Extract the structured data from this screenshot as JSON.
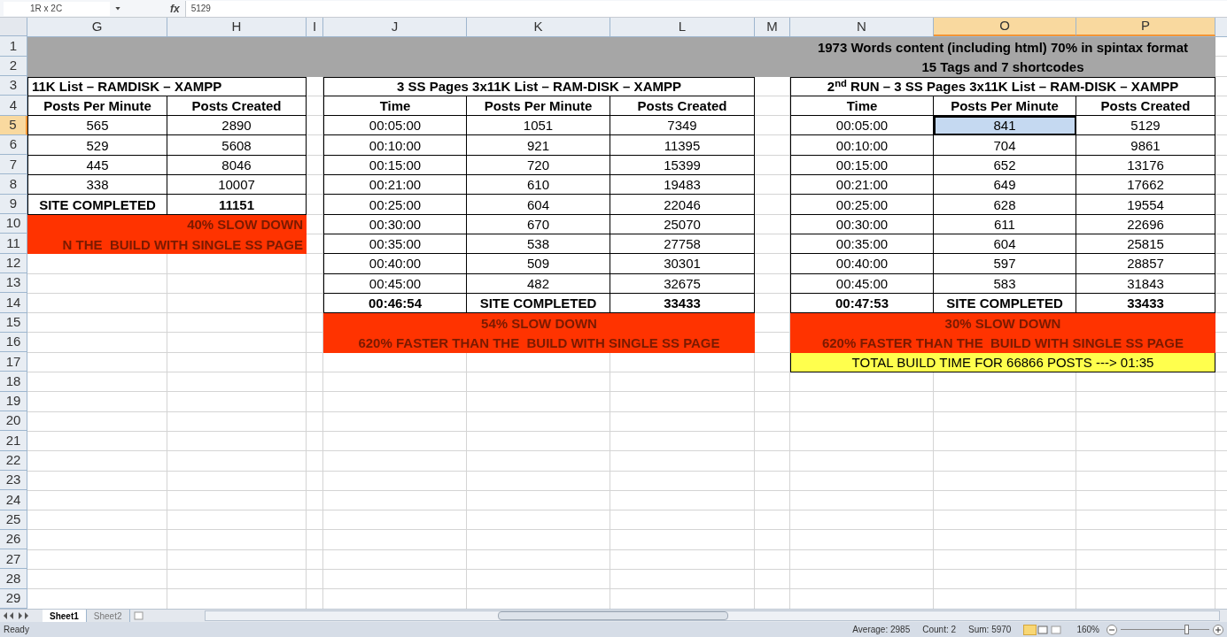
{
  "formula_bar": {
    "name_box": "1R x 2C",
    "function_label": "fx",
    "value": "5129"
  },
  "columns": [
    {
      "label": "G",
      "selected": false
    },
    {
      "label": "H",
      "selected": false
    },
    {
      "label": "I",
      "selected": false
    },
    {
      "label": "J",
      "selected": false
    },
    {
      "label": "K",
      "selected": false
    },
    {
      "label": "L",
      "selected": false
    },
    {
      "label": "M",
      "selected": false
    },
    {
      "label": "N",
      "selected": false
    },
    {
      "label": "O",
      "selected": true
    },
    {
      "label": "P",
      "selected": true
    }
  ],
  "row_headers": [
    {
      "label": "1",
      "selected": false
    },
    {
      "label": "2",
      "selected": false
    },
    {
      "label": "3",
      "selected": false
    },
    {
      "label": "4",
      "selected": false
    },
    {
      "label": "5",
      "selected": true
    },
    {
      "label": "6",
      "selected": false
    },
    {
      "label": "7",
      "selected": false
    },
    {
      "label": "8",
      "selected": false
    },
    {
      "label": "9",
      "selected": false
    },
    {
      "label": "10",
      "selected": false
    },
    {
      "label": "11",
      "selected": false
    },
    {
      "label": "12",
      "selected": false
    },
    {
      "label": "13",
      "selected": false
    },
    {
      "label": "14",
      "selected": false
    },
    {
      "label": "15",
      "selected": false
    },
    {
      "label": "16",
      "selected": false
    },
    {
      "label": "17",
      "selected": false
    },
    {
      "label": "18",
      "selected": false
    },
    {
      "label": "19",
      "selected": false
    },
    {
      "label": "20",
      "selected": false
    },
    {
      "label": "21",
      "selected": false
    },
    {
      "label": "22",
      "selected": false
    },
    {
      "label": "23",
      "selected": false
    },
    {
      "label": "24",
      "selected": false
    },
    {
      "label": "25",
      "selected": false
    },
    {
      "label": "26",
      "selected": false
    },
    {
      "label": "27",
      "selected": false
    },
    {
      "label": "28",
      "selected": false
    },
    {
      "label": "29",
      "selected": false
    }
  ],
  "banner": [
    "1973 Words content (including html) 70% in spintax format",
    "15 Tags and 7 shortcodes"
  ],
  "tables": [
    {
      "title": "11K List – RAMDISK – XAMPP",
      "headers": [
        "Posts Per Minute",
        "Posts Created"
      ],
      "rows": [
        [
          {
            "text": "565",
            "selected": false
          },
          {
            "text": "2890",
            "selected": false
          }
        ],
        [
          {
            "text": "529",
            "selected": false
          },
          {
            "text": "5608",
            "selected": false
          }
        ],
        [
          {
            "text": "445",
            "selected": false
          },
          {
            "text": "8046",
            "selected": false
          }
        ],
        [
          {
            "text": "338",
            "selected": false
          },
          {
            "text": "10007",
            "selected": false
          }
        ]
      ],
      "summary": [
        "SITE COMPLETED",
        "11151"
      ],
      "alerts": [
        "40% SLOW DOWN",
        "N THE  BUILD WITH SINGLE SS PAGE"
      ]
    },
    {
      "title": "3 SS Pages 3x11K List – RAM-DISK – XAMPP",
      "headers": [
        "Time",
        "Posts Per Minute",
        "Posts Created"
      ],
      "rows": [
        [
          {
            "text": "00:05:00",
            "selected": false
          },
          {
            "text": "1051",
            "selected": false
          },
          {
            "text": "7349",
            "selected": false
          }
        ],
        [
          {
            "text": "00:10:00",
            "selected": false
          },
          {
            "text": "921",
            "selected": false
          },
          {
            "text": "11395",
            "selected": false
          }
        ],
        [
          {
            "text": "00:15:00",
            "selected": false
          },
          {
            "text": "720",
            "selected": false
          },
          {
            "text": "15399",
            "selected": false
          }
        ],
        [
          {
            "text": "00:21:00",
            "selected": false
          },
          {
            "text": "610",
            "selected": false
          },
          {
            "text": "19483",
            "selected": false
          }
        ],
        [
          {
            "text": "00:25:00",
            "selected": false
          },
          {
            "text": "604",
            "selected": false
          },
          {
            "text": "22046",
            "selected": false
          }
        ],
        [
          {
            "text": "00:30:00",
            "selected": false
          },
          {
            "text": "670",
            "selected": false
          },
          {
            "text": "25070",
            "selected": false
          }
        ],
        [
          {
            "text": "00:35:00",
            "selected": false
          },
          {
            "text": "538",
            "selected": false
          },
          {
            "text": "27758",
            "selected": false
          }
        ],
        [
          {
            "text": "00:40:00",
            "selected": false
          },
          {
            "text": "509",
            "selected": false
          },
          {
            "text": "30301",
            "selected": false
          }
        ],
        [
          {
            "text": "00:45:00",
            "selected": false
          },
          {
            "text": "482",
            "selected": false
          },
          {
            "text": "32675",
            "selected": false
          }
        ]
      ],
      "summary": [
        "00:46:54",
        "SITE COMPLETED",
        "33433"
      ],
      "alerts": [
        "54% SLOW DOWN",
        "620% FASTER THAN THE  BUILD WITH SINGLE SS PAGE"
      ]
    },
    {
      "title": "2$^{nd}$ RUN – 3 SS Pages 3x11K List – RAM-DISK – XAMPP",
      "headers": [
        "Time",
        "Posts Per Minute",
        "Posts Created"
      ],
      "rows": [
        [
          {
            "text": "00:05:00",
            "selected": false
          },
          {
            "text": "841",
            "selected": true
          },
          {
            "text": "5129",
            "selected": false
          }
        ],
        [
          {
            "text": "00:10:00",
            "selected": false
          },
          {
            "text": "704",
            "selected": false
          },
          {
            "text": "9861",
            "selected": false
          }
        ],
        [
          {
            "text": "00:15:00",
            "selected": false
          },
          {
            "text": "652",
            "selected": false
          },
          {
            "text": "13176",
            "selected": false
          }
        ],
        [
          {
            "text": "00:21:00",
            "selected": false
          },
          {
            "text": "649",
            "selected": false
          },
          {
            "text": "17662",
            "selected": false
          }
        ],
        [
          {
            "text": "00:25:00",
            "selected": false
          },
          {
            "text": "628",
            "selected": false
          },
          {
            "text": "19554",
            "selected": false
          }
        ],
        [
          {
            "text": "00:30:00",
            "selected": false
          },
          {
            "text": "611",
            "selected": false
          },
          {
            "text": "22696",
            "selected": false
          }
        ],
        [
          {
            "text": "00:35:00",
            "selected": false
          },
          {
            "text": "604",
            "selected": false
          },
          {
            "text": "25815",
            "selected": false
          }
        ],
        [
          {
            "text": "00:40:00",
            "selected": false
          },
          {
            "text": "597",
            "selected": false
          },
          {
            "text": "28857",
            "selected": false
          }
        ],
        [
          {
            "text": "00:45:00",
            "selected": false
          },
          {
            "text": "583",
            "selected": false
          },
          {
            "text": "31843",
            "selected": false
          }
        ]
      ],
      "summary": [
        "00:47:53",
        "SITE COMPLETED",
        "33433"
      ],
      "alerts": [
        "30% SLOW DOWN",
        "620% FASTER THAN THE  BUILD WITH SINGLE SS PAGE"
      ],
      "note": "TOTAL BUILD TIME FOR 66866 POSTS ---> 01:35"
    }
  ],
  "sheet_tabs": [
    {
      "label": "Sheet1",
      "selected": true
    },
    {
      "label": "Sheet2",
      "selected": false
    }
  ],
  "status_bar": {
    "status": "Ready",
    "average": "Average: 2985",
    "count": "Count: 2",
    "sum": "Sum: 5970",
    "zoom": "160%",
    "level": 0.75
  }
}
